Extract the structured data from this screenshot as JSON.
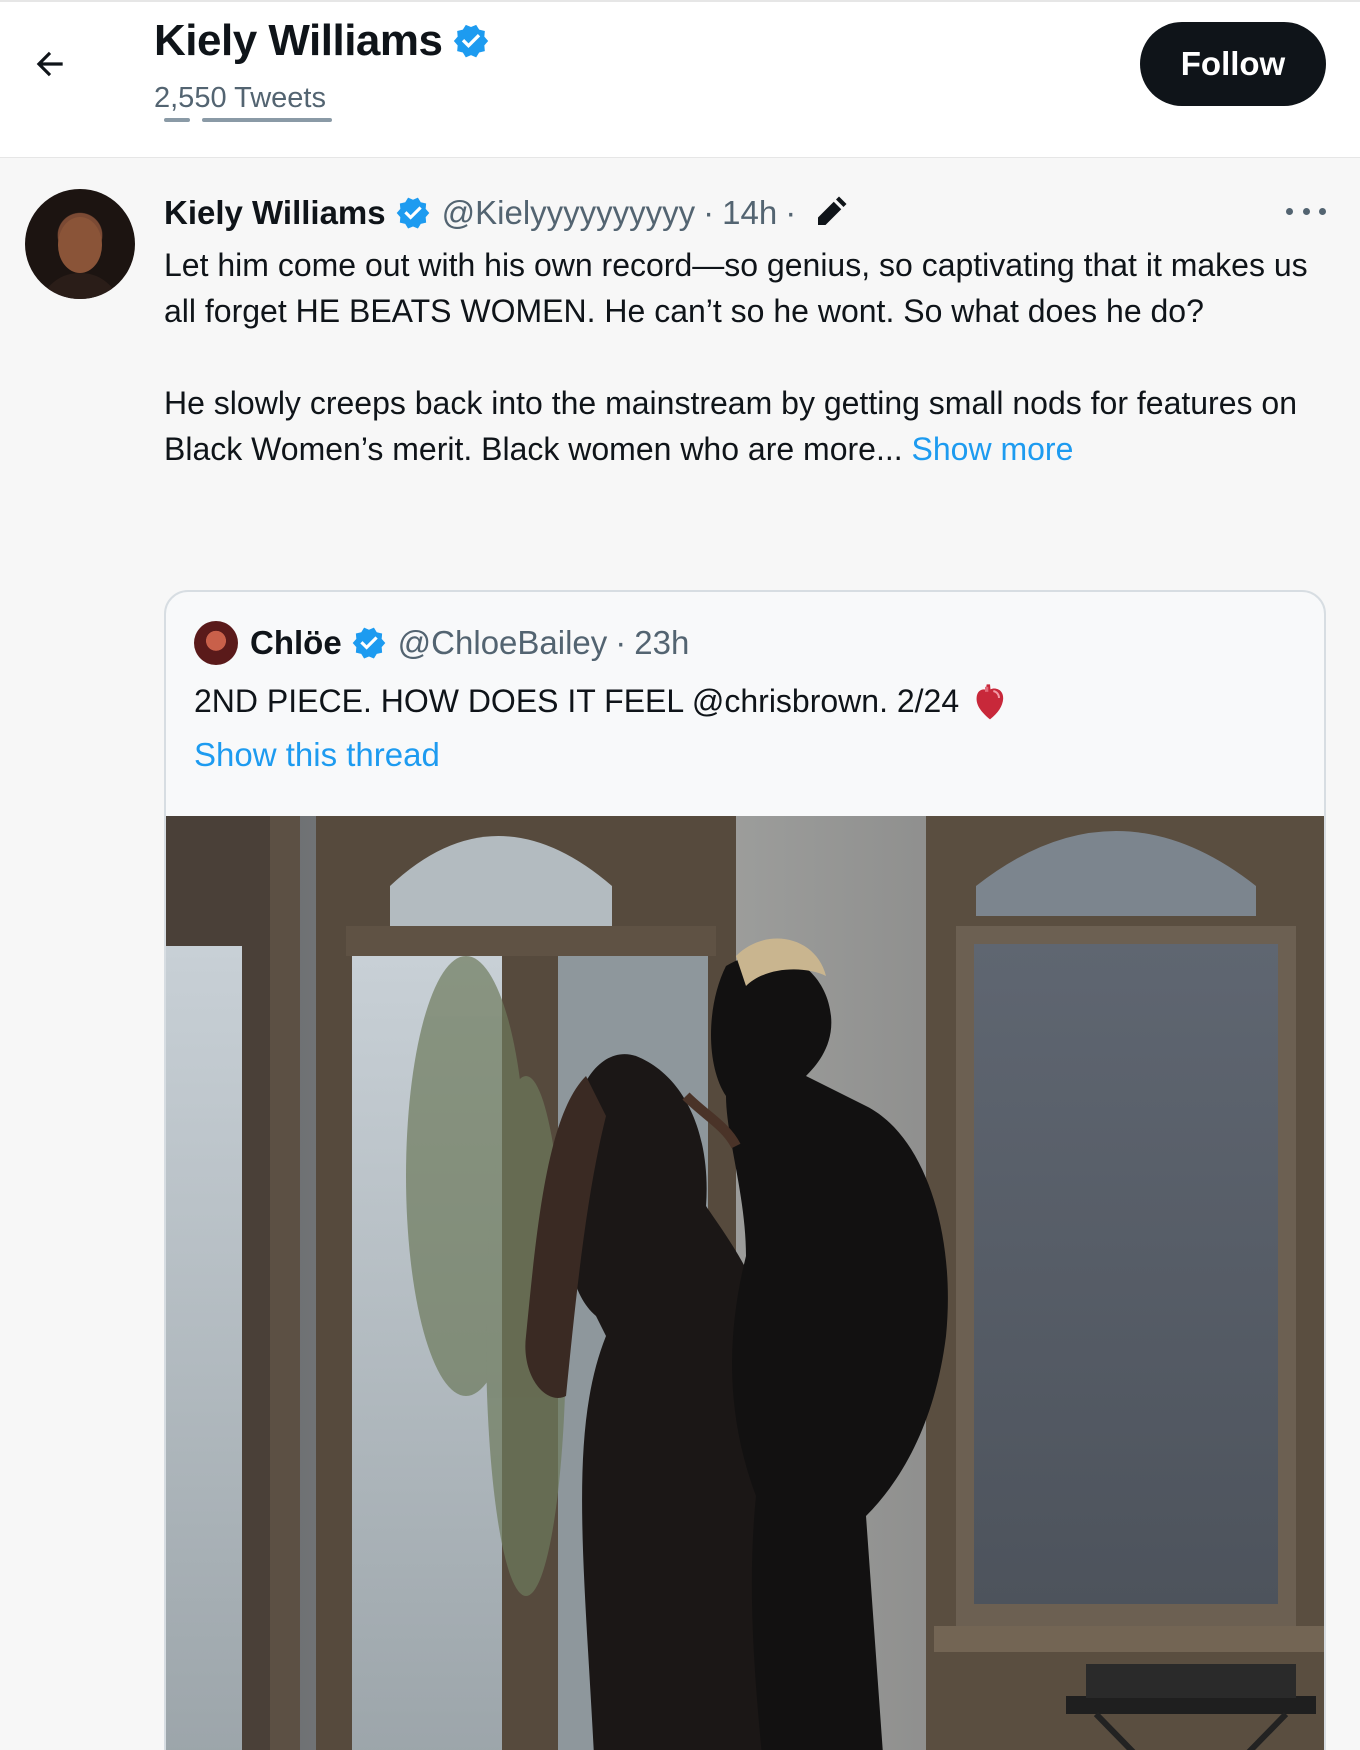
{
  "header": {
    "back_icon": "arrow-left-icon",
    "title": "Kiely Williams",
    "tweet_count": "2,550 Tweets",
    "follow_label": "Follow",
    "verified_icon": "verified-badge-icon"
  },
  "tweet": {
    "author": "Kiely Williams",
    "handle": "@Kielyyyyyyyyyy",
    "separator": "·",
    "time": "14h",
    "edited_icon": "edit-pencil-icon",
    "more_icon": "more-dots-icon",
    "paragraph1": "Let him come out with his own record—so genius, so captivating that it makes us all forget HE BEATS WOMEN. He can’t so he wont. So what does he do?",
    "paragraph2": "He slowly creeps back into the mainstream by getting small nods for features on Black Women’s merit. Black women who are more...",
    "show_more": "Show more"
  },
  "quote": {
    "author": "Chlöe",
    "handle": "@ChloeBailey",
    "separator": "·",
    "time": "23h",
    "text": "2ND PIECE. HOW DOES IT FEEL @chrisbrown. 2/24",
    "heart_icon": "anatomical-heart-icon",
    "show_thread": "Show this thread"
  },
  "colors": {
    "accent": "#1d9bf0",
    "text": "#0f1419",
    "muted": "#536471",
    "follow_bg": "#0f1419"
  }
}
